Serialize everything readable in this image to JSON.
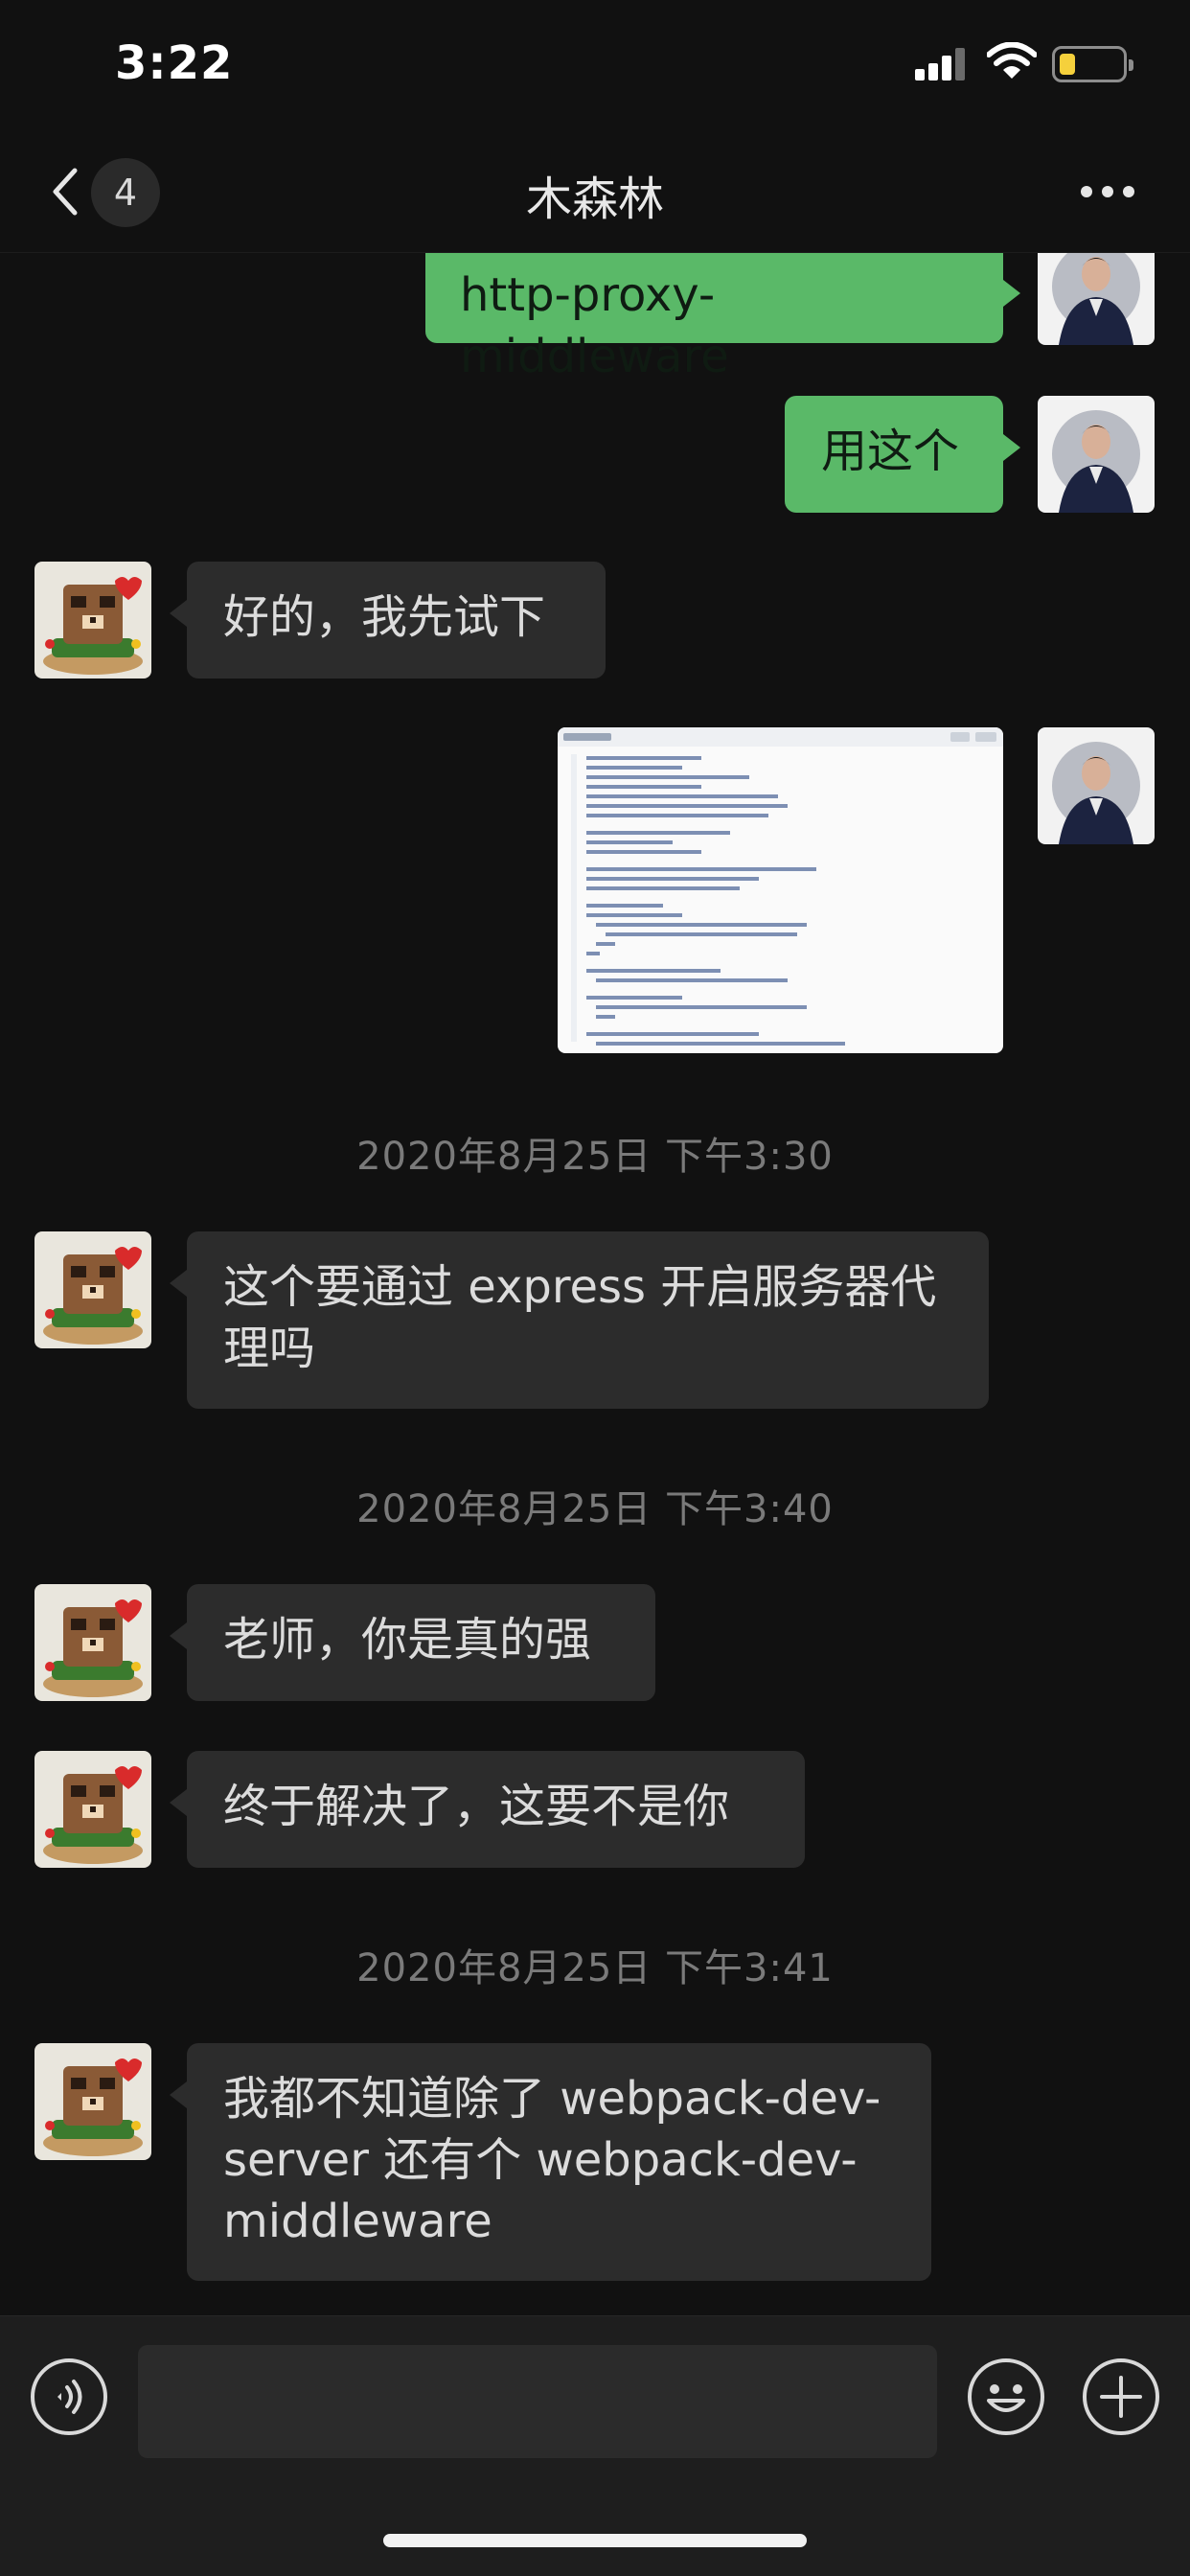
{
  "status_bar": {
    "time": "3:22"
  },
  "nav": {
    "unread_count": "4",
    "title": "木森林"
  },
  "messages": [
    {
      "side": "out",
      "text": "http-proxy-middleware"
    },
    {
      "side": "out",
      "text": "用这个"
    },
    {
      "side": "in",
      "text": "好的，我先试下"
    },
    {
      "side": "out",
      "type": "image",
      "image_desc": "code screenshot"
    },
    {
      "timestamp": "2020年8月25日 下午3:30"
    },
    {
      "side": "in",
      "text": "这个要通过 express 开启服务器代理吗"
    },
    {
      "timestamp": "2020年8月25日 下午3:40"
    },
    {
      "side": "in",
      "text": "老师，你是真的强"
    },
    {
      "side": "in",
      "text": "终于解决了，这要不是你"
    },
    {
      "timestamp": "2020年8月25日 下午3:41"
    },
    {
      "side": "in",
      "text": "我都不知道除了 webpack-dev-server 还有个 webpack-dev-middleware"
    }
  ],
  "input": {
    "value": "",
    "placeholder": ""
  },
  "colors": {
    "outgoing_bubble": "#5ab968",
    "incoming_bubble": "#2c2c2c",
    "background": "#111111"
  },
  "icons": [
    "back-icon",
    "more-icon",
    "voice-icon",
    "emoji-icon",
    "plus-icon",
    "signal-icon",
    "wifi-icon",
    "battery-icon"
  ]
}
